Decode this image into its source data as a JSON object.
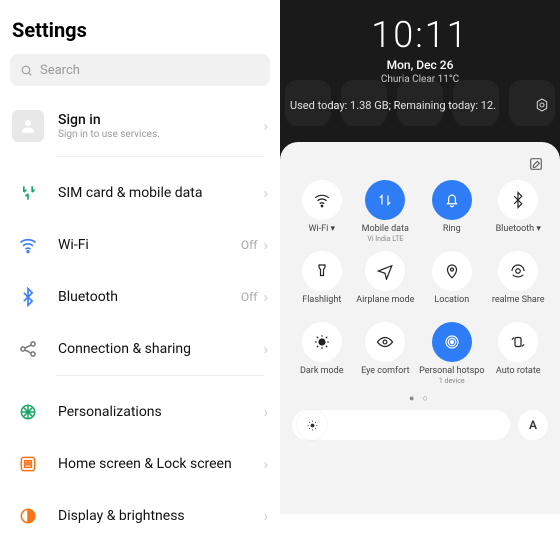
{
  "settings": {
    "title": "Settings",
    "search_placeholder": "Search",
    "signin": {
      "title": "Sign in",
      "subtitle": "Sign in to use services."
    },
    "rows": [
      {
        "label": "SIM card & mobile data",
        "status": ""
      },
      {
        "label": "Wi-Fi",
        "status": "Off"
      },
      {
        "label": "Bluetooth",
        "status": "Off"
      },
      {
        "label": "Connection & sharing",
        "status": ""
      },
      {
        "label": "Personalizations",
        "status": ""
      },
      {
        "label": "Home screen & Lock screen",
        "status": ""
      },
      {
        "label": "Display & brightness",
        "status": ""
      }
    ]
  },
  "lock": {
    "time": "10:11",
    "date": "Mon, Dec 26",
    "weather": "Churia Clear 11°C",
    "usage": "Used today: 1.38 GB; Remaining today: 12."
  },
  "panel": {
    "tiles": [
      {
        "label": "Wi-Fi ▾",
        "sub": "",
        "active": false
      },
      {
        "label": "Mobile data",
        "sub": "Vi India LTE",
        "active": true
      },
      {
        "label": "Ring",
        "sub": "",
        "active": true
      },
      {
        "label": "Bluetooth ▾",
        "sub": "",
        "active": false
      },
      {
        "label": "Flashlight",
        "sub": "",
        "active": false
      },
      {
        "label": "Airplane mode",
        "sub": "",
        "active": false
      },
      {
        "label": "Location",
        "sub": "",
        "active": false
      },
      {
        "label": "realme Share",
        "sub": "",
        "active": false
      },
      {
        "label": "Dark mode",
        "sub": "",
        "active": false
      },
      {
        "label": "Eye comfort",
        "sub": "",
        "active": false
      },
      {
        "label": "Personal hotspo",
        "sub": "1 device",
        "active": true
      },
      {
        "label": "Auto rotate",
        "sub": "",
        "active": false
      }
    ],
    "auto": "A"
  }
}
